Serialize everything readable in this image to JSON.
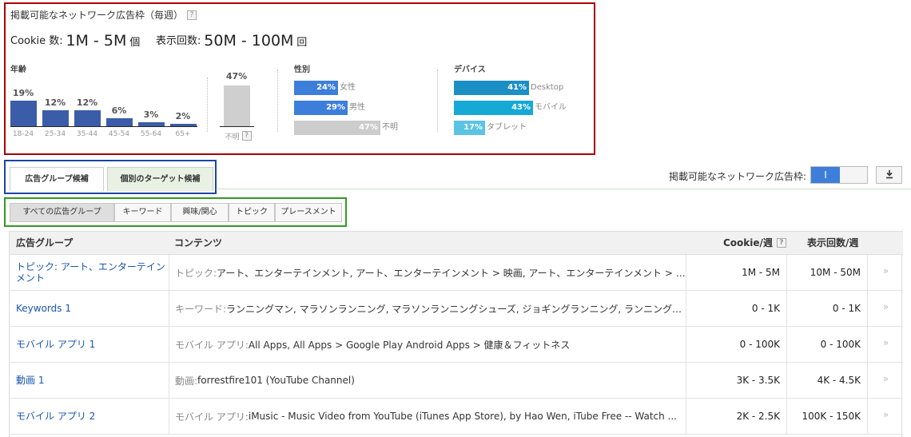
{
  "reach": {
    "title": "掲載可能なネットワーク広告枠（毎週）",
    "help_icon": "?",
    "cookie_label": "Cookie 数:",
    "cookie_value": "1M - 5M",
    "cookie_unit": "個",
    "impressions_label": "表示回数:",
    "impressions_value": "50M - 100M",
    "impressions_unit": "回",
    "age": {
      "label": "年齢",
      "categories": [
        "18-24",
        "25-34",
        "35-44",
        "45-54",
        "55-64",
        "65+"
      ],
      "percents": [
        19,
        12,
        12,
        6,
        3,
        2
      ],
      "percent_labels": [
        "19%",
        "12%",
        "12%",
        "6%",
        "3%",
        "2%"
      ],
      "unknown_percent": 47,
      "unknown_percent_label": "47%",
      "unknown_label": "不明",
      "bar_color": "#3b5ca8",
      "unknown_color": "#cfcfcf"
    },
    "gender": {
      "label": "性別",
      "items": [
        {
          "percent": 24,
          "percent_label": "24%",
          "label": "女性",
          "color": "#3d7edb"
        },
        {
          "percent": 29,
          "percent_label": "29%",
          "label": "男性",
          "color": "#3d7edb"
        },
        {
          "percent": 47,
          "percent_label": "47%",
          "label": "不明",
          "color": "#cccccc"
        }
      ]
    },
    "device": {
      "label": "デバイス",
      "items": [
        {
          "percent": 41,
          "percent_label": "41%",
          "label": "Desktop",
          "color": "#1c8fc4"
        },
        {
          "percent": 43,
          "percent_label": "43%",
          "label": "モバイル",
          "color": "#16a9d6"
        },
        {
          "percent": 17,
          "percent_label": "17%",
          "label": "タブレット",
          "color": "#5bc3e3"
        }
      ]
    }
  },
  "tabs": [
    {
      "label": "広告グループ候補",
      "active": true
    },
    {
      "label": "個別のターゲット候補",
      "active": false
    }
  ],
  "inventory_toggle": {
    "label": "掲載可能なネットワーク広告枠:",
    "state_glyph": "I",
    "accent": "#3d7edb"
  },
  "download_icon": "download-icon",
  "filters": [
    "すべての広告グループ",
    "キーワード",
    "興味/関心",
    "トピック",
    "プレースメント"
  ],
  "table": {
    "headers": {
      "group": "広告グループ",
      "content": "コンテンツ",
      "cookie": "Cookie/週",
      "impressions": "表示回数/週"
    },
    "rows": [
      {
        "name": "トピック: アート、エンターテインメント",
        "prefix": "トピック: ",
        "content": "アート、エンターテインメント, アート、エンターテインメント > 映画, アート、エンターテインメント > 音楽、オ...",
        "cookie": "1M - 5M",
        "impressions": "10M - 50M"
      },
      {
        "name": "Keywords 1",
        "prefix": "キーワード: ",
        "content": "ランニングマン, マラソンランニング, マラソンランニングシューズ, ジョギングランニング, ランニングシュ...",
        "cookie": "0 - 1K",
        "impressions": "0 - 1K"
      },
      {
        "name": "モバイル アプリ 1",
        "prefix": "モバイル アプリ: ",
        "content": "All Apps, All Apps > Google Play Android Apps > 健康＆フィットネス",
        "cookie": "0 - 100K",
        "impressions": "0 - 100K"
      },
      {
        "name": "動画 1",
        "prefix": "動画: ",
        "content": "forrestfire101 (YouTube Channel)",
        "cookie": "3K - 3.5K",
        "impressions": "4K - 4.5K"
      },
      {
        "name": "モバイル アプリ 2",
        "prefix": "モバイル アプリ: ",
        "content": "iMusic - Music Video from YouTube (iTunes App Store), by Hao Wen, iTube Free -- Watch ...",
        "cookie": "2K - 2.5K",
        "impressions": "100K - 150K"
      }
    ],
    "row_action_glyph": "»"
  }
}
